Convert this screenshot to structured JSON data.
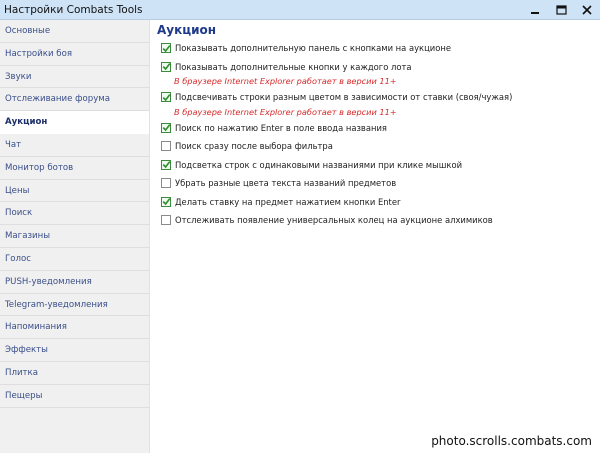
{
  "window": {
    "title": "Настройки Combats Tools"
  },
  "sidebar": {
    "items": [
      {
        "label": "Основные"
      },
      {
        "label": "Настройки боя"
      },
      {
        "label": "Звуки"
      },
      {
        "label": "Отслеживание форума"
      },
      {
        "label": "Аукцион",
        "active": true
      },
      {
        "label": "Чат"
      },
      {
        "label": "Монитор ботов"
      },
      {
        "label": "Цены"
      },
      {
        "label": "Поиск"
      },
      {
        "label": "Магазины"
      },
      {
        "label": "Голос"
      },
      {
        "label": "PUSH-уведомления"
      },
      {
        "label": "Telegram-уведомления"
      },
      {
        "label": "Напоминания"
      },
      {
        "label": "Эффекты"
      },
      {
        "label": "Плитка"
      },
      {
        "label": "Пещеры"
      }
    ]
  },
  "main": {
    "heading": "Аукцион",
    "options": [
      {
        "label": "Показывать дополнительную панель с кнопками на аукционе",
        "checked": true
      },
      {
        "label": "Показывать дополнительные кнопки у каждого лота",
        "checked": true,
        "note": "В браузере Internet Explorer работает в версии 11+"
      },
      {
        "label": "Подсвечивать строки разным цветом в зависимости от ставки (своя/чужая)",
        "checked": true,
        "note": "В браузере Internet Explorer работает в версии 11+"
      },
      {
        "label": "Поиск по нажатию Enter в поле ввода названия",
        "checked": true
      },
      {
        "label": "Поиск сразу после выбора фильтра",
        "checked": false
      },
      {
        "label": "Подсветка строк с одинаковыми названиями при клике мышкой",
        "checked": true
      },
      {
        "label": "Убрать разные цвета текста названий предметов",
        "checked": false
      },
      {
        "label": "Делать ставку на предмет нажатием кнопки Enter",
        "checked": true
      },
      {
        "label": "Отслеживать появление универсальных колец на аукционе алхимиков",
        "checked": false
      }
    ]
  },
  "watermark": "photo.scrolls.combats.com",
  "colors": {
    "titlebar": "#cfe3f6",
    "sidebar_bg": "#f0f0f0",
    "link": "#3a4f8a",
    "heading": "#1f3a8a",
    "note": "#d62b2b",
    "check": "#2e8b2e"
  }
}
